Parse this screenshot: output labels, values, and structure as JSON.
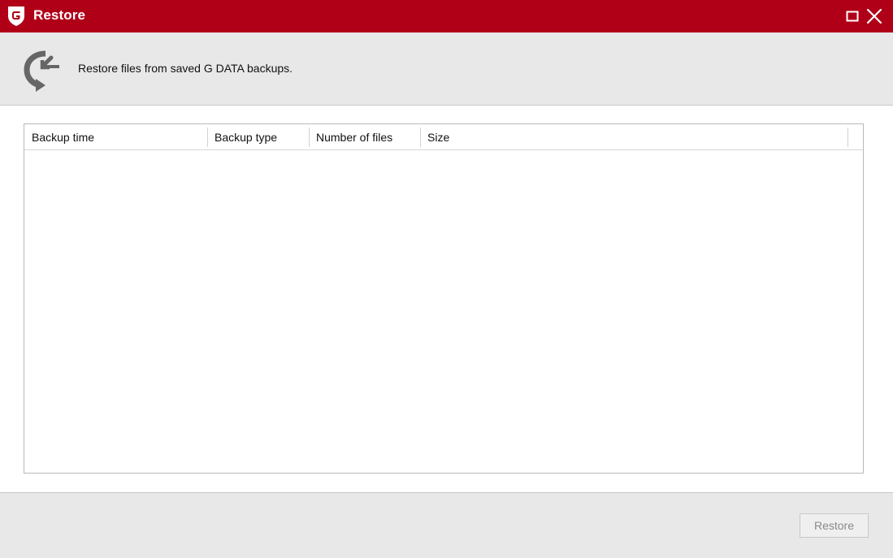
{
  "window": {
    "title": "Restore",
    "brand_color": "#b00018",
    "icons": {
      "app": "gdata-logo-icon",
      "maximize": "maximize-icon",
      "close": "close-icon"
    }
  },
  "header": {
    "description": "Restore files from saved G DATA backups.",
    "icon": "restore-icon"
  },
  "list": {
    "columns": [
      {
        "label": "Backup time"
      },
      {
        "label": "Backup type"
      },
      {
        "label": "Number of files"
      },
      {
        "label": "Size"
      }
    ],
    "rows": []
  },
  "footer": {
    "restore_label": "Restore",
    "restore_enabled": false
  }
}
